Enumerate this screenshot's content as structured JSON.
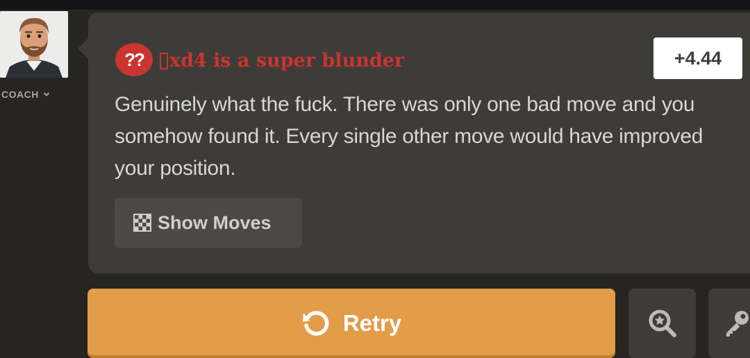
{
  "coach": {
    "label": "COACH",
    "avatar_icon": "bearded-man-avatar",
    "dropdown_icon": "chevron-down-icon"
  },
  "feedback": {
    "badge": "??",
    "piece_icon": "missing-glyph-box",
    "verdict": "xd4 is a super blunder",
    "evaluation": "+4.44",
    "message": "Genuinely what the fuck. There was only one bad move and you somehow found it. Every single other move would have improved your position.",
    "show_moves_label": "Show Moves",
    "show_moves_icon": "chessboard-icon"
  },
  "actions": {
    "retry_label": "Retry",
    "retry_icon": "retry-icon",
    "analysis_icon": "magnifier-star-icon",
    "key_icon": "key-icon"
  },
  "colors": {
    "background": "#262522",
    "bubble": "#3d3c39",
    "blunder_red": "#ca3431",
    "retry_orange": "#e39c47",
    "eval_box": "#ffffff"
  }
}
